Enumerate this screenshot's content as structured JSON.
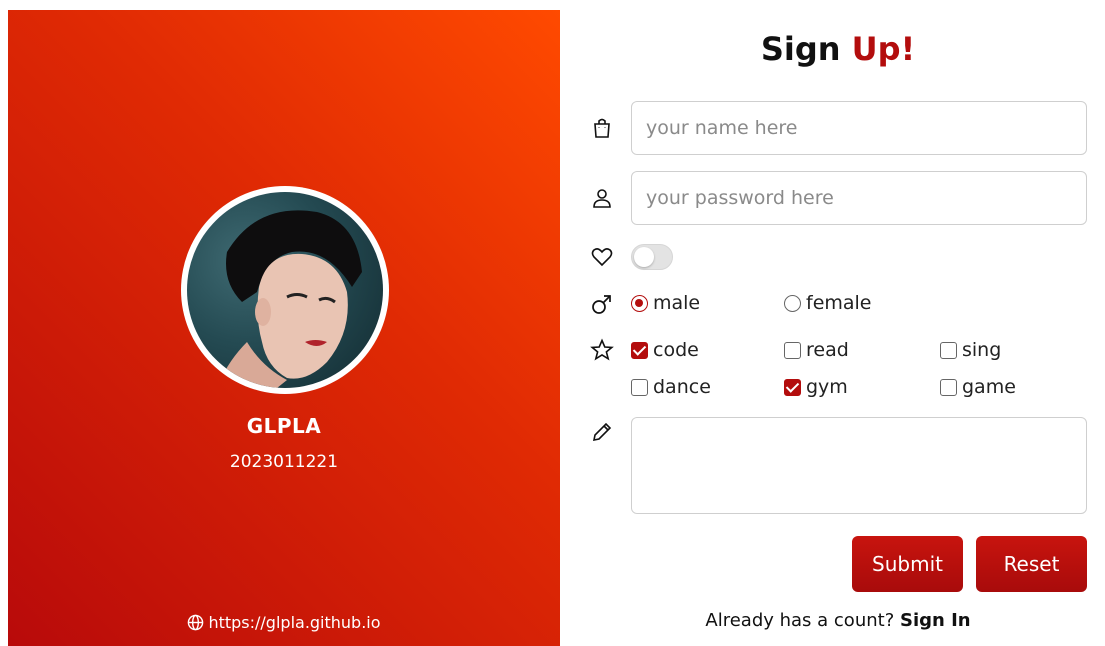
{
  "profile": {
    "name": "GLPLA",
    "id": "2023011221",
    "link": "https://glpla.github.io",
    "avatar_alt": "profile photo"
  },
  "form": {
    "title_main": "Sign ",
    "title_accent": "Up!",
    "name_placeholder": "your name here",
    "password_placeholder": "your password here",
    "toggle_on": false,
    "gender": {
      "options": [
        "male",
        "female"
      ],
      "selected": "male"
    },
    "hobbies": [
      {
        "label": "code",
        "checked": true
      },
      {
        "label": "read",
        "checked": false
      },
      {
        "label": "sing",
        "checked": false
      },
      {
        "label": "dance",
        "checked": false
      },
      {
        "label": "gym",
        "checked": true
      },
      {
        "label": "game",
        "checked": false
      }
    ],
    "submit_label": "Submit",
    "reset_label": "Reset",
    "signin_prompt": "Already has a count?",
    "signin_link": "Sign In"
  },
  "icons": {
    "name_row": "shopping-bag-icon",
    "password_row": "person-icon",
    "toggle_row": "heart-icon",
    "gender_row": "male-symbol-icon",
    "hobby_row": "star-icon",
    "note_row": "pencil-icon",
    "link": "globe-icon"
  },
  "colors": {
    "accent": "#b30d0d",
    "panel_top": "#ff4a00",
    "panel_bottom": "#b80a0a"
  }
}
